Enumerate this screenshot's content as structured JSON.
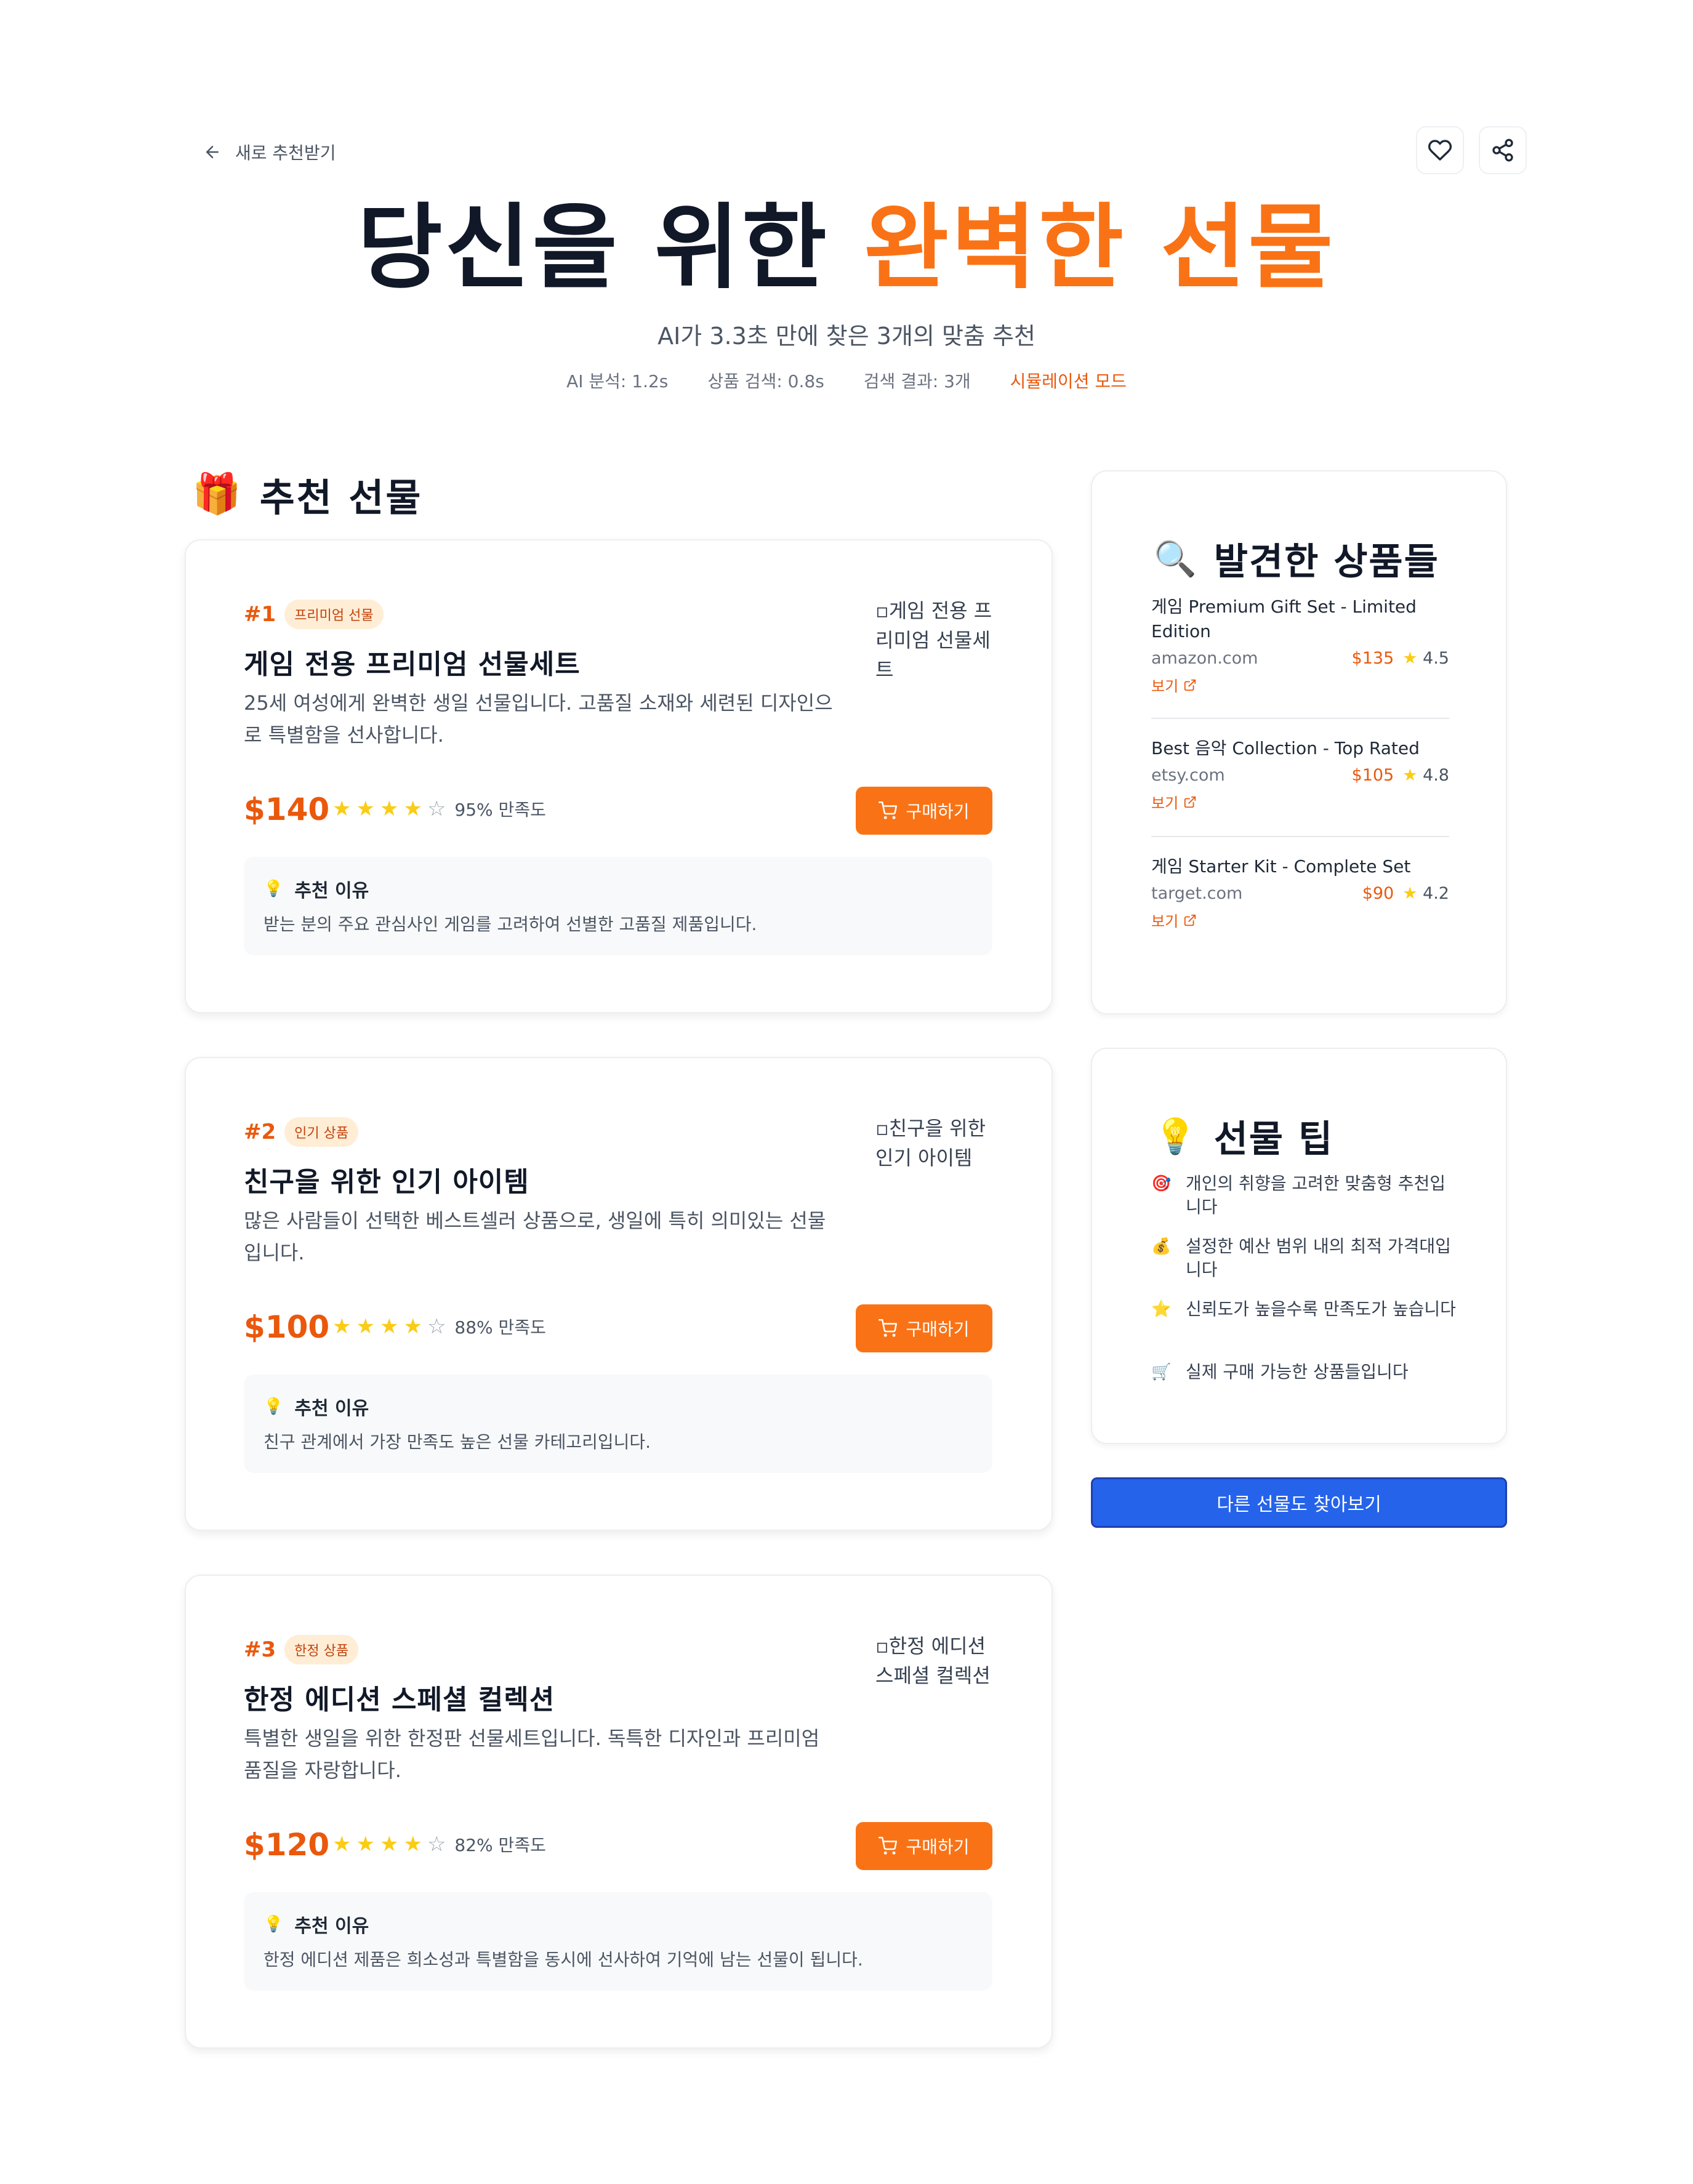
{
  "header": {
    "back_label": "새로 추천받기",
    "title_plain": "당신을 위한",
    "title_accent": "완벽한 선물",
    "subtitle": "AI가 3.3초 만에 찾은 3개의 맞춤 추천",
    "stats": [
      "AI 분석: 1.2s",
      "상품 검색: 0.8s",
      "검색 결과: 3개"
    ],
    "mode": "시뮬레이션 모드"
  },
  "section": {
    "emoji": "🎁",
    "title": "추천 선물"
  },
  "gifts": [
    {
      "rank": "#1",
      "badge": "프리미엄 선물",
      "name": "게임 전용 프리미엄 선물세트",
      "description": "25세 여성에게 완벽한 생일 선물입니다. 고품질 소재와 세련된 디자인으로 특별함을 선사합니다.",
      "image_alt": "게임 전용 프리미엄 선물세트",
      "price": "$140",
      "rating": 4,
      "satisfaction": "95% 만족도",
      "buy_label": "구매하기",
      "reason_title": "추천 이유",
      "reason": "받는 분의 주요 관심사인 게임를 고려하여 선별한 고품질 제품입니다."
    },
    {
      "rank": "#2",
      "badge": "인기 상품",
      "name": "친구을 위한 인기 아이템",
      "description": "많은 사람들이 선택한 베스트셀러 상품으로, 생일에 특히 의미있는 선물입니다.",
      "image_alt": "친구을 위한 인기 아이템",
      "price": "$100",
      "rating": 4,
      "satisfaction": "88% 만족도",
      "buy_label": "구매하기",
      "reason_title": "추천 이유",
      "reason": "친구 관계에서 가장 만족도 높은 선물 카테고리입니다."
    },
    {
      "rank": "#3",
      "badge": "한정 상품",
      "name": "한정 에디션 스페셜 컬렉션",
      "description": "특별한 생일을 위한 한정판 선물세트입니다. 독특한 디자인과 프리미엄 품질을 자랑합니다.",
      "image_alt": "한정 에디션 스페셜 컬렉션",
      "price": "$120",
      "rating": 4,
      "satisfaction": "82% 만족도",
      "buy_label": "구매하기",
      "reason_title": "추천 이유",
      "reason": "한정 에디션 제품은 희소성과 특별함을 동시에 선사하여 기억에 남는 선물이 됩니다."
    }
  ],
  "found_products": {
    "emoji": "🔍",
    "title": "발견한 상품들",
    "items": [
      {
        "name": "게임 Premium Gift Set - Limited Edition",
        "store": "amazon.com",
        "price": "$135",
        "rating": "4.5",
        "view": "보기"
      },
      {
        "name": "Best 음악 Collection - Top Rated",
        "store": "etsy.com",
        "price": "$105",
        "rating": "4.8",
        "view": "보기"
      },
      {
        "name": "게임 Starter Kit - Complete Set",
        "store": "target.com",
        "price": "$90",
        "rating": "4.2",
        "view": "보기"
      }
    ]
  },
  "tips": {
    "emoji": "💡",
    "title": "선물 팁",
    "items": [
      {
        "icon": "🎯",
        "text": "개인의 취향을 고려한 맞춤형 추천입니다"
      },
      {
        "icon": "💰",
        "text": "설정한 예산 범위 내의 최적 가격대입니다"
      },
      {
        "icon": "⭐",
        "text": "신뢰도가 높을수록 만족도가 높습니다"
      },
      {
        "icon": "🛒",
        "text": "실제 구매 가능한 상품들입니다"
      }
    ]
  },
  "cta_label": "다른 선물도 찾아보기",
  "colors": {
    "accent": "#f97316",
    "accent_dark": "#ea580c",
    "cta": "#2563eb",
    "star": "#facc15"
  }
}
